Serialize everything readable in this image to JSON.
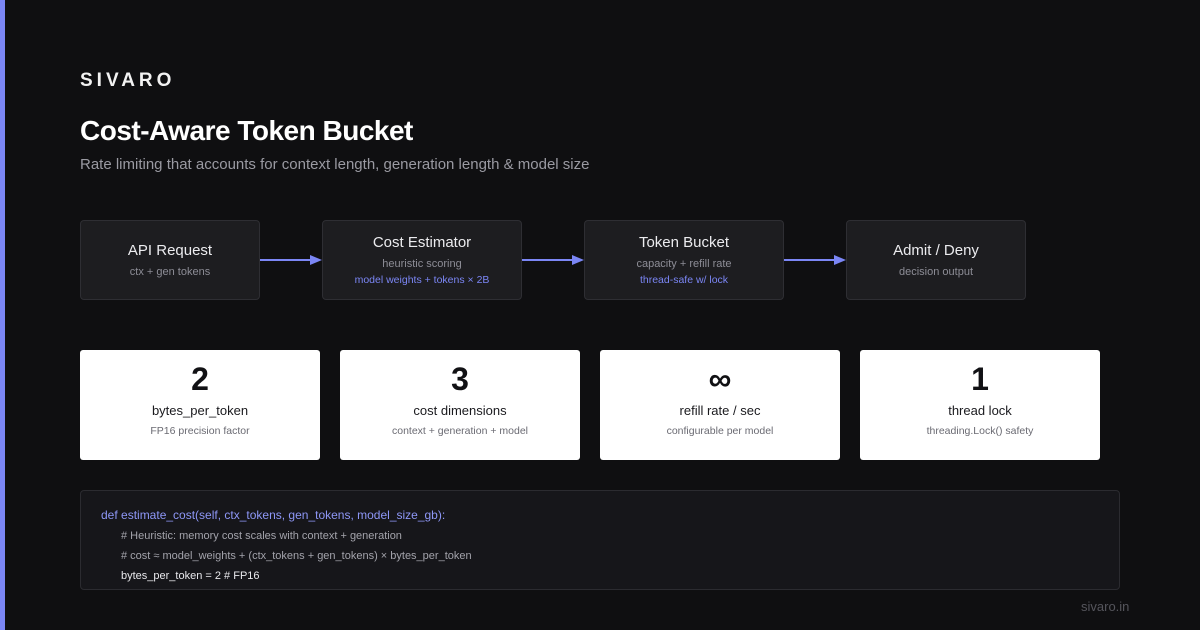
{
  "brand": "SIVARO",
  "title": "Cost-Aware Token Bucket",
  "subtitle": "Rate limiting that accounts for context length, generation length & model size",
  "flow": [
    {
      "title": "API Request",
      "sub": "ctx + gen tokens",
      "sub2": ""
    },
    {
      "title": "Cost Estimator",
      "sub": "heuristic scoring",
      "sub2": "model weights + tokens × 2B"
    },
    {
      "title": "Token Bucket",
      "sub": "capacity + refill rate",
      "sub2": "thread-safe w/ lock"
    },
    {
      "title": "Admit / Deny",
      "sub": "decision output",
      "sub2": ""
    }
  ],
  "stats": [
    {
      "value": "2",
      "label": "bytes_per_token",
      "sub": "FP16 precision factor"
    },
    {
      "value": "3",
      "label": "cost dimensions",
      "sub": "context + generation + model"
    },
    {
      "value": "∞",
      "label": "refill rate / sec",
      "sub": "configurable per model"
    },
    {
      "value": "1",
      "label": "thread lock",
      "sub": "threading.Lock() safety"
    }
  ],
  "code": {
    "def_line": "def estimate_cost(self, ctx_tokens, gen_tokens, model_size_gb):",
    "comment1": "# Heuristic: memory cost scales with context + generation",
    "comment2": "# cost ≈ model_weights + (ctx_tokens + gen_tokens) × bytes_per_token",
    "statement": "bytes_per_token = 2 # FP16"
  },
  "footer": "sivaro.in",
  "colors": {
    "accent": "#7b86f5",
    "background": "#0f0f11",
    "card": "#ffffff"
  }
}
